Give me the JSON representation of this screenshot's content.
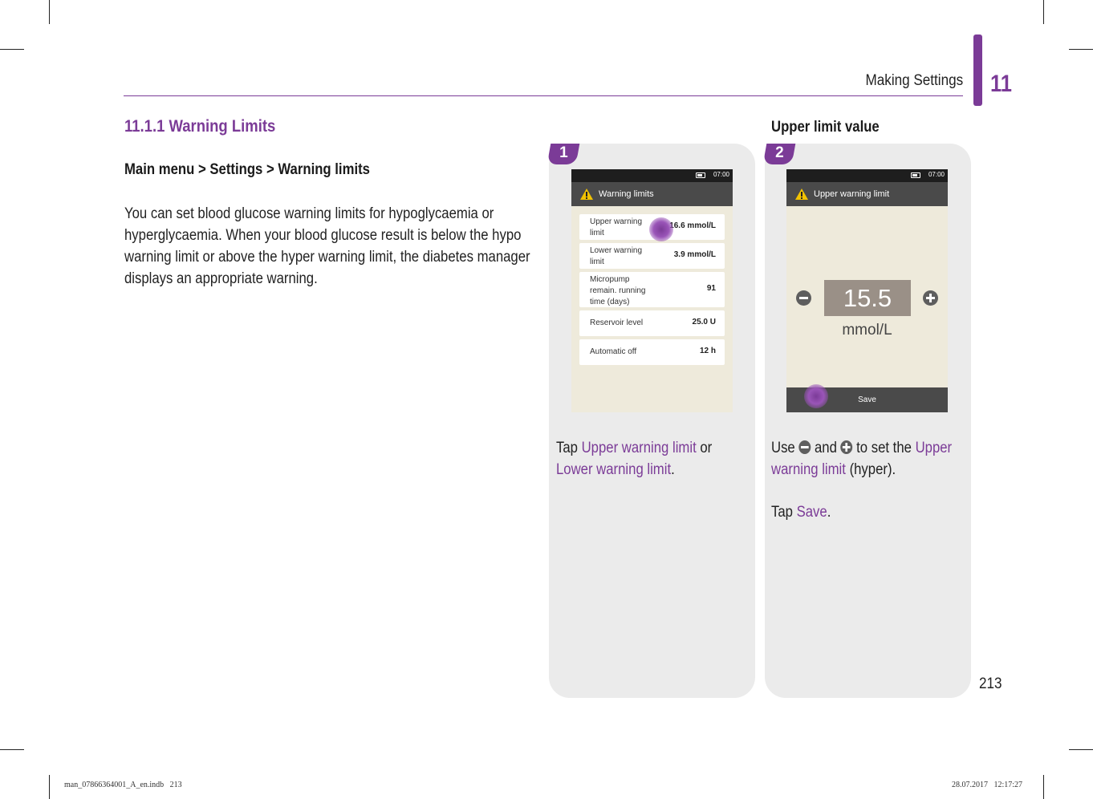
{
  "header": {
    "title": "Making Settings",
    "chapter": "11",
    "accent_color": "#7b3b97"
  },
  "section": {
    "title": "11.1.1 Warning Limits",
    "breadcrumb": "Main menu > Settings > Warning limits",
    "body": "You can set blood glucose warning limits for hypoglycaemia or hyperglycaemia. When your blood glucose result is below the hypo warning limit or above the hyper warning limit, the diabetes manager displays an appropriate warning."
  },
  "step2_heading": "Upper limit value",
  "step1": {
    "badge": "1",
    "screen": {
      "time": "07:00",
      "title": "Warning limits",
      "rows": [
        {
          "label": "Upper warning limit",
          "value": "16.6 mmol/L"
        },
        {
          "label": "Lower warning limit",
          "value": "3.9 mmol/L"
        },
        {
          "label": "Micropump remain. running time (days)",
          "value": "91"
        },
        {
          "label": "Reservoir level",
          "value": "25.0 U"
        },
        {
          "label": "Automatic off",
          "value": "12 h"
        }
      ]
    },
    "caption": {
      "pre": "Tap ",
      "link1": "Upper warning limit",
      "mid": " or ",
      "link2": "Lower warning limit",
      "post": "."
    }
  },
  "step2": {
    "badge": "2",
    "screen": {
      "time": "07:00",
      "title": "Upper warning limit",
      "value": "15.5",
      "unit": "mmol/L",
      "save_label": "Save"
    },
    "caption": {
      "use": "Use ",
      "minus_icon": "minus-circle-icon",
      "and": " and ",
      "plus_icon": "plus-circle-icon",
      "to_set": " to set the ",
      "link": "Upper warning limit",
      "hyper": " (hyper).",
      "tap": "Tap ",
      "save_link": "Save",
      "end": "."
    }
  },
  "page_number": "213",
  "footer": {
    "left": "man_07866364001_A_en.indb   213",
    "right": "28.07.2017   12:17:27"
  }
}
